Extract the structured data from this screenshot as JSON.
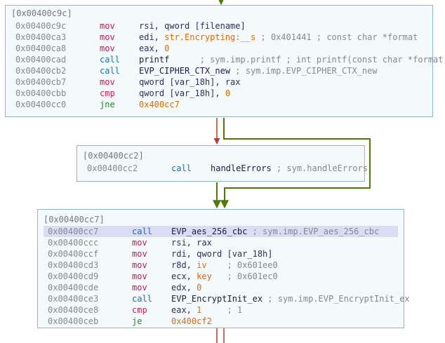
{
  "blocks": [
    {
      "title": "[0x00400c9c]",
      "lines": [
        {
          "addr": "0x00400c9c",
          "mnem": "mov",
          "mnem_class": "mov",
          "parts": [
            {
              "t": "rsi, qword [filename]",
              "c": "plain"
            }
          ]
        },
        {
          "addr": "0x00400ca3",
          "mnem": "mov",
          "mnem_class": "mov",
          "parts": [
            {
              "t": "edi, ",
              "c": "plain"
            },
            {
              "t": "str.Encrypting:__s",
              "c": "str"
            },
            {
              "t": " ; 0x401441 ; const char *format",
              "c": "cmt"
            }
          ]
        },
        {
          "addr": "0x00400ca8",
          "mnem": "mov",
          "mnem_class": "mov",
          "parts": [
            {
              "t": "eax, ",
              "c": "plain"
            },
            {
              "t": "0",
              "c": "num"
            }
          ]
        },
        {
          "addr": "0x00400cad",
          "mnem": "call",
          "mnem_class": "call",
          "parts": [
            {
              "t": "printf",
              "c": "func"
            },
            {
              "t": "      ; sym.imp.printf ; int printf(const char *format)",
              "c": "cmt"
            }
          ]
        },
        {
          "addr": "0x00400cb2",
          "mnem": "call",
          "mnem_class": "call",
          "parts": [
            {
              "t": "EVP_CIPHER_CTX_new",
              "c": "func"
            },
            {
              "t": " ; sym.imp.EVP_CIPHER_CTX_new",
              "c": "cmt"
            }
          ]
        },
        {
          "addr": "0x00400cb7",
          "mnem": "mov",
          "mnem_class": "mov",
          "parts": [
            {
              "t": "qword [var_18h], rax",
              "c": "plain"
            }
          ]
        },
        {
          "addr": "0x00400cbb",
          "mnem": "cmp",
          "mnem_class": "cmp",
          "parts": [
            {
              "t": "qword [var_18h], ",
              "c": "plain"
            },
            {
              "t": "0",
              "c": "num"
            }
          ]
        },
        {
          "addr": "0x00400cc0",
          "mnem": "jne",
          "mnem_class": "jne",
          "parts": [
            {
              "t": "0x400cc7",
              "c": "imm"
            }
          ]
        }
      ]
    },
    {
      "title": "[0x00400cc2]",
      "lines": [
        {
          "addr": "0x00400cc2",
          "mnem": "call",
          "mnem_class": "call",
          "parts": [
            {
              "t": "handleErrors",
              "c": "func"
            },
            {
              "t": " ; sym.handleErrors",
              "c": "cmt"
            }
          ]
        }
      ]
    },
    {
      "title": "[0x00400cc7]",
      "lines": [
        {
          "addr": "0x00400cc7",
          "mnem": "call",
          "mnem_class": "call",
          "highlight": true,
          "parts": [
            {
              "t": "EVP_aes_256_cbc",
              "c": "func"
            },
            {
              "t": " ; sym.imp.EVP_aes_256_cbc",
              "c": "cmt"
            }
          ]
        },
        {
          "addr": "0x00400ccc",
          "mnem": "mov",
          "mnem_class": "mov",
          "parts": [
            {
              "t": "rsi, rax",
              "c": "plain"
            }
          ]
        },
        {
          "addr": "0x00400ccf",
          "mnem": "mov",
          "mnem_class": "mov",
          "parts": [
            {
              "t": "rdi, qword [var_18h]",
              "c": "plain"
            }
          ]
        },
        {
          "addr": "0x00400cd3",
          "mnem": "mov",
          "mnem_class": "mov",
          "parts": [
            {
              "t": "r8d, ",
              "c": "plain"
            },
            {
              "t": "iv",
              "c": "str"
            },
            {
              "t": "    ; 0x601ee0",
              "c": "cmt"
            }
          ]
        },
        {
          "addr": "0x00400cd9",
          "mnem": "mov",
          "mnem_class": "mov",
          "parts": [
            {
              "t": "ecx, ",
              "c": "plain"
            },
            {
              "t": "key",
              "c": "str"
            },
            {
              "t": "   ; 0x601ec0",
              "c": "cmt"
            }
          ]
        },
        {
          "addr": "0x00400cde",
          "mnem": "mov",
          "mnem_class": "mov",
          "parts": [
            {
              "t": "edx, ",
              "c": "plain"
            },
            {
              "t": "0",
              "c": "num"
            }
          ]
        },
        {
          "addr": "0x00400ce3",
          "mnem": "call",
          "mnem_class": "call",
          "parts": [
            {
              "t": "EVP_EncryptInit_ex",
              "c": "func"
            },
            {
              "t": " ; sym.imp.EVP_EncryptInit_ex",
              "c": "cmt"
            }
          ]
        },
        {
          "addr": "0x00400ce8",
          "mnem": "cmp",
          "mnem_class": "cmp",
          "parts": [
            {
              "t": "eax, ",
              "c": "plain"
            },
            {
              "t": "1",
              "c": "num"
            },
            {
              "t": "     ; 1",
              "c": "cmt"
            }
          ]
        },
        {
          "addr": "0x00400ceb",
          "mnem": "je",
          "mnem_class": "je",
          "parts": [
            {
              "t": "0x400cf2",
              "c": "imm"
            }
          ]
        }
      ]
    }
  ],
  "colors": {
    "edge_true": "#4d7a00",
    "edge_false": "#c0392b",
    "block_border": "#8fb4cf",
    "block_bg": "#f4f9fc"
  }
}
